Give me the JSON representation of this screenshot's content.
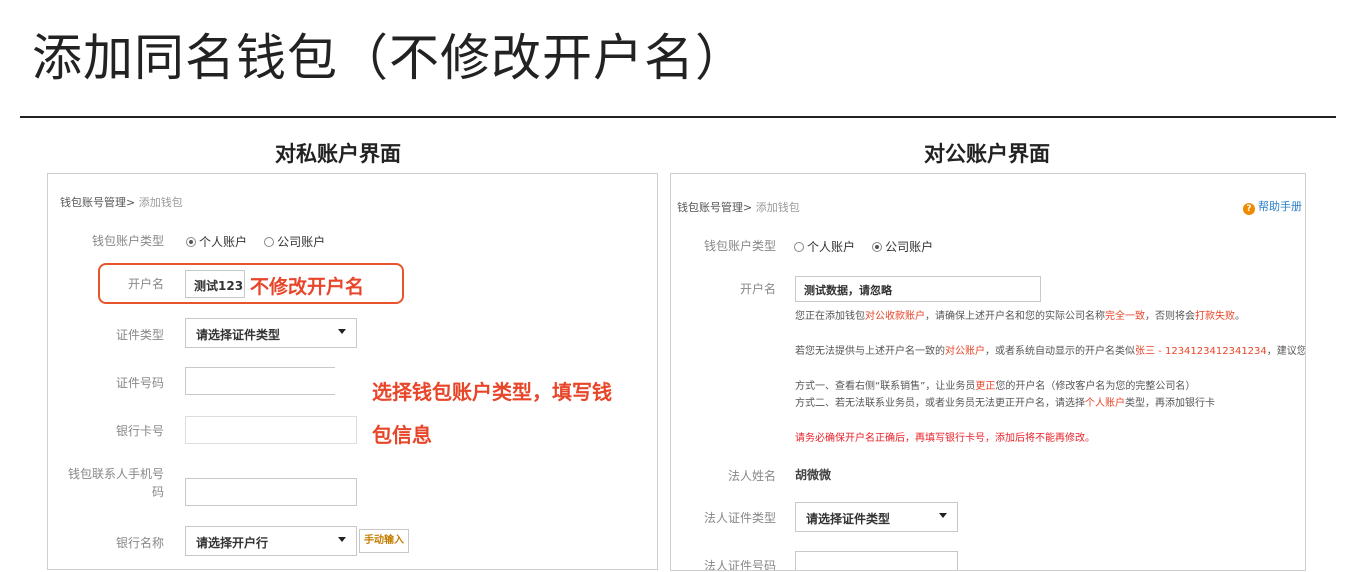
{
  "main_title": "添加同名钱包（不修改开户名）",
  "left": {
    "section_title": "对私账户界面",
    "breadcrumb": {
      "parent": "钱包账号管理>",
      "current": " 添加钱包"
    },
    "wallet_type_label": "钱包账户类型",
    "radio_personal": "个人账户",
    "radio_company": "公司账户",
    "account_name_label": "开户名",
    "account_name_value": "测试123",
    "annotation_no_modify": "不修改开户名",
    "id_type_label": "证件类型",
    "id_type_select": "请选择证件类型",
    "id_number_label": "证件号码",
    "annotation_line1": "选择钱包账户类型，填写钱",
    "annotation_line2": "包信息",
    "bank_card_label": "银行卡号",
    "phone_label_line1": "钱包联系人手机号",
    "phone_label_line2": "码",
    "bank_name_label": "银行名称",
    "bank_select": "请选择开户行",
    "manual_input_button": "手动输入"
  },
  "right": {
    "section_title": "对公账户界面",
    "breadcrumb": {
      "parent": "钱包账号管理>",
      "current": " 添加钱包"
    },
    "help_label": "帮助手册",
    "wallet_type_label": "钱包账户类型",
    "radio_personal": "个人账户",
    "radio_company": "公司账户",
    "account_name_label": "开户名",
    "account_name_value": "测试数据，请忽略",
    "notice1": {
      "a": "您正在添加钱包",
      "b": "对公收款账户",
      "c": "，请确保上述开户名和您的实际公司名称",
      "d": "完全一致",
      "e": "，否则将会",
      "f": "打款失败",
      "g": "。"
    },
    "notice2": {
      "a": "若您无法提供与上述开户名一致的",
      "b": "对公账户",
      "c": "，或者系统自动显示的开户名类似",
      "d": "张三 - 1234123412341234",
      "e": "，建议您："
    },
    "method1": {
      "a": "方式一、查看右侧“联系销售”，让业务员",
      "b": "更正",
      "c": "您的开户名（修改客户名为您的完整公司名）"
    },
    "method2": {
      "a": "方式二、若无法联系业务员，或者业务员无法更正开户名，请选择",
      "b": "个人账户",
      "c": "类型，再添加银行卡"
    },
    "warning": "请务必确保开户名正确后，再填写银行卡号，添加后将不能再修改。",
    "legal_name_label": "法人姓名",
    "legal_name_value": "胡微微",
    "legal_id_type_label": "法人证件类型",
    "legal_id_type_select": "请选择证件类型",
    "legal_id_number_label": "法人证件号码"
  },
  "colors": {
    "accent_red": "#e8462a",
    "help_orange": "#f08a00"
  }
}
